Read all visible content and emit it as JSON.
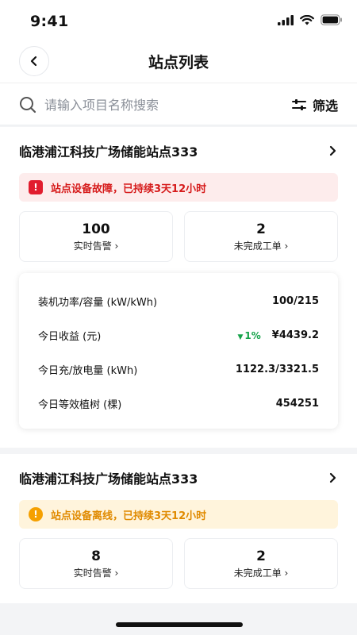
{
  "status_bar": {
    "time": "9:41"
  },
  "nav": {
    "title": "站点列表"
  },
  "search": {
    "placeholder": "请输入项目名称搜索",
    "filter_label": "筛选"
  },
  "stations": [
    {
      "name": "临港浦江科技广场储能站点333",
      "alert": {
        "type": "error",
        "text": "站点设备故障，已持续3天12小时",
        "color": "#d61b1b"
      },
      "stats": [
        {
          "value": "100",
          "label": "实时告警 ›"
        },
        {
          "value": "2",
          "label": "未完成工单 ›"
        }
      ],
      "metrics": [
        {
          "label": "装机功率/容量 (kW/kWh)",
          "value": "100/215"
        },
        {
          "label": "今日收益 (元)",
          "trend": "1%",
          "value": "¥4439.2"
        },
        {
          "label": "今日充/放电量 (kWh)",
          "value": "1122.3/3321.5"
        },
        {
          "label": "今日等效植树 (棵)",
          "value": "454251"
        }
      ]
    },
    {
      "name": "临港浦江科技广场储能站点333",
      "alert": {
        "type": "warning",
        "text": "站点设备离线，已持续3天12小时",
        "color": "#e08a00"
      },
      "stats": [
        {
          "value": "8",
          "label": "实时告警 ›"
        },
        {
          "value": "2",
          "label": "未完成工单 ›"
        }
      ]
    }
  ],
  "colors": {
    "accent_red": "#e11d2e",
    "accent_yellow": "#f5a000",
    "trend_green": "#16a34a"
  }
}
